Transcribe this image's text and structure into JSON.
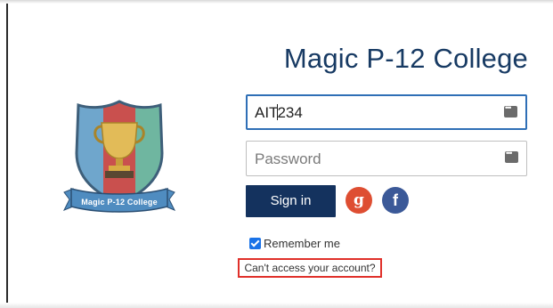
{
  "college": {
    "title": "Magic P-12 College",
    "logo_banner_text": "Magic P-12 College"
  },
  "login": {
    "username_value": "AIT234",
    "password_placeholder": "Password",
    "signin_label": "Sign in",
    "google_label": "g",
    "facebook_label": "f",
    "remember_label": "Remember me",
    "remember_checked": true,
    "cant_access_label": "Can't access your account?"
  },
  "colors": {
    "title": "#173a63",
    "signin_button": "#14325e",
    "google": "#de4e32",
    "facebook": "#3b5998",
    "focus_border": "#2f6fb6",
    "highlight_box": "#e0302a"
  },
  "icons": {
    "username_field_icon": "password-manager-icon",
    "password_field_icon": "password-manager-icon",
    "google": "google-icon",
    "facebook": "facebook-icon",
    "checkbox": "checkbox-checked-icon"
  }
}
